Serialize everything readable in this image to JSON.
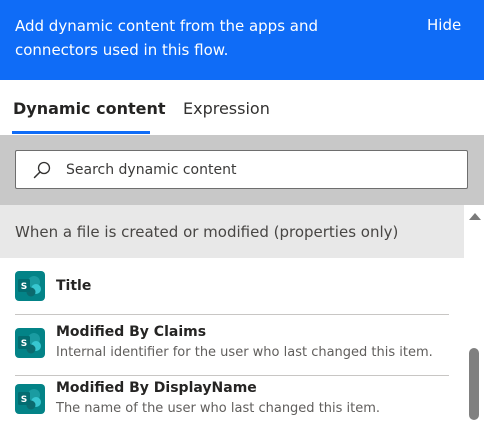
{
  "banner": {
    "message": "Add dynamic content from the apps and connectors used in this flow.",
    "hide_label": "Hide"
  },
  "tabs": [
    {
      "label": "Dynamic content",
      "active": true
    },
    {
      "label": "Expression",
      "active": false
    }
  ],
  "search": {
    "placeholder": "Search dynamic content",
    "value": ""
  },
  "group": {
    "title": "When a file is created or modified (properties only)"
  },
  "items": [
    {
      "title": "Title",
      "description": "",
      "icon": "sharepoint-icon"
    },
    {
      "title": "Modified By Claims",
      "description": "Internal identifier for the user who last changed this item.",
      "icon": "sharepoint-icon"
    },
    {
      "title": "Modified By DisplayName",
      "description": "The name of the user who last changed this item.",
      "icon": "sharepoint-icon"
    }
  ],
  "colors": {
    "banner": "#0f6cf7",
    "accent": "#0f6cf7",
    "sharepoint": "#038387",
    "search_area": "#c8c8c8",
    "group_header": "#e8e8e8"
  }
}
